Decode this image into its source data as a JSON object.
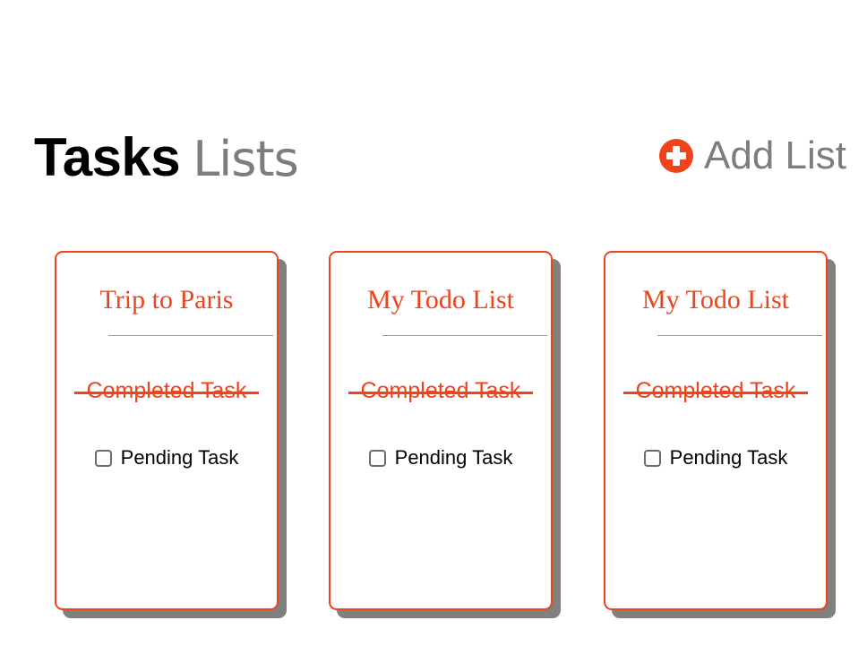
{
  "header": {
    "title_bold": "Tasks",
    "title_light": "Lists",
    "add_list_label": "Add List",
    "add_list_icon": "plus-circle-icon"
  },
  "colors": {
    "accent": "#f0421b",
    "muted_text": "#7d7d7d",
    "shadow": "#808080"
  },
  "lists": [
    {
      "title": "Trip to Paris",
      "completed_task": "Completed Task",
      "pending_task": "Pending Task"
    },
    {
      "title": "My Todo List",
      "completed_task": "Completed Task",
      "pending_task": "Pending Task"
    },
    {
      "title": "My Todo List",
      "completed_task": "Completed Task",
      "pending_task": "Pending Task"
    }
  ]
}
